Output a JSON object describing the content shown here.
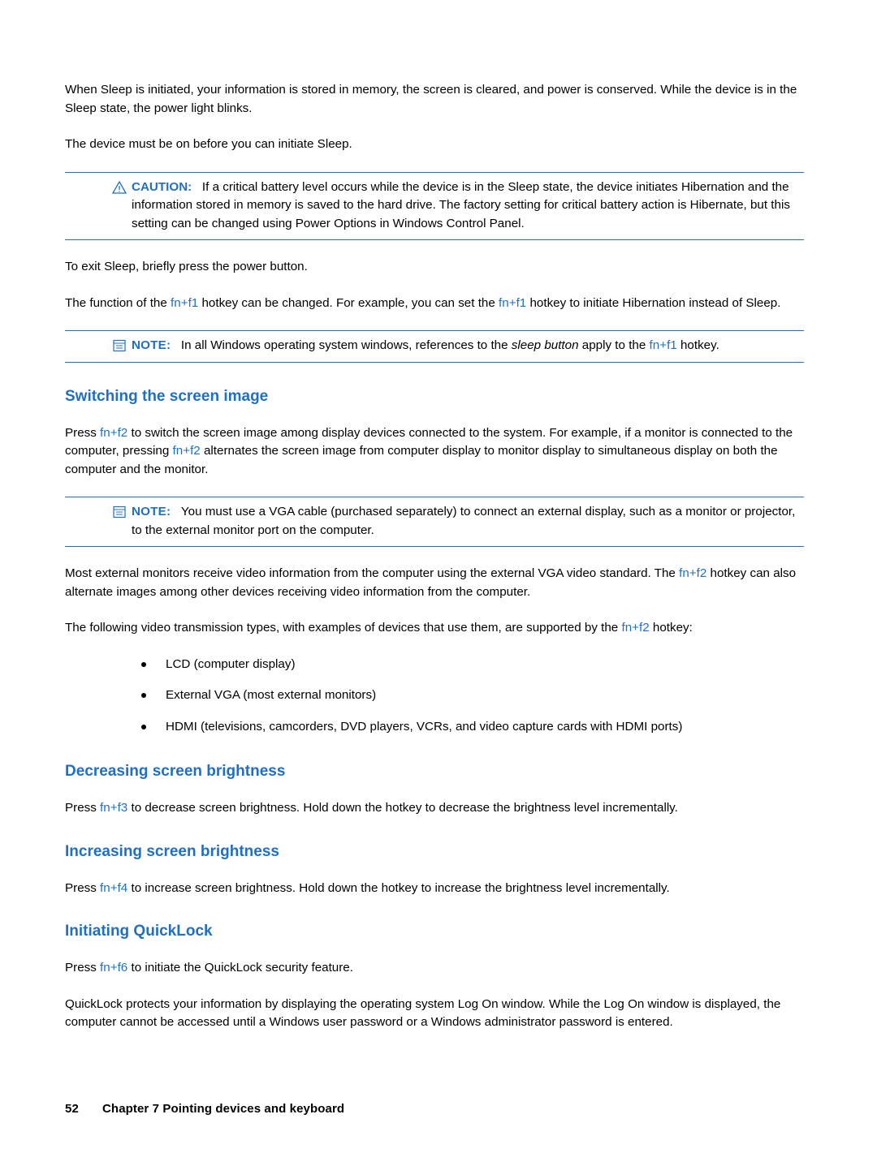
{
  "page": {
    "paragraphs": {
      "p1": "When Sleep is initiated, your information is stored in memory, the screen is cleared, and power is conserved. While the device is in the Sleep state, the power light blinks.",
      "p2": "The device must be on before you can initiate Sleep.",
      "p3": "To exit Sleep, briefly press the power button.",
      "p4a": "The function of the ",
      "p4b": " hotkey can be changed. For example, you can set the ",
      "p4c": " hotkey to initiate Hibernation instead of Sleep.",
      "p5a": "Press ",
      "p5b": " to switch the screen image among display devices connected to the system. For example, if a monitor is connected to the computer, pressing ",
      "p5c": " alternates the screen image from computer display to monitor display to simultaneous display on both the computer and the monitor.",
      "p6a": "Most external monitors receive video information from the computer using the external VGA video standard. The ",
      "p6b": " hotkey can also alternate images among other devices receiving video information from the computer.",
      "p7a": "The following video transmission types, with examples of devices that use them, are supported by the ",
      "p7b": " hotkey:",
      "p8a": "Press ",
      "p8b": " to decrease screen brightness. Hold down the hotkey to decrease the brightness level incrementally.",
      "p9a": "Press ",
      "p9b": " to increase screen brightness. Hold down the hotkey to increase the brightness level incrementally.",
      "p10a": "Press ",
      "p10b": " to initiate the QuickLock security feature.",
      "p11": "QuickLock protects your information by displaying the operating system Log On window. While the Log On window is displayed, the computer cannot be accessed until a Windows user password or a Windows administrator password is entered."
    },
    "callouts": {
      "caution": {
        "label": "CAUTION:",
        "text": "If a critical battery level occurs while the device is in the Sleep state, the device initiates Hibernation and the information stored in memory is saved to the hard drive. The factory setting for critical battery action is Hibernate, but this setting can be changed using Power Options in Windows Control Panel."
      },
      "note1": {
        "label": "NOTE:",
        "text_a": "In all Windows operating system windows, references to the ",
        "text_em": "sleep button",
        "text_b": " apply to the ",
        "text_c": " hotkey."
      },
      "note2": {
        "label": "NOTE:",
        "text": "You must use a VGA cable (purchased separately) to connect an external display, such as a monitor or projector, to the external monitor port on the computer."
      }
    },
    "headings": {
      "h1": "Switching the screen image",
      "h2": "Decreasing screen brightness",
      "h3": "Increasing screen brightness",
      "h4": "Initiating QuickLock"
    },
    "hotkeys": {
      "fn_f1": "fn+f1",
      "fn_f2": "fn+f2",
      "fn_f3": "fn+f3",
      "fn_f4": "fn+f4",
      "fn_f6": "fn+f6"
    },
    "bullets": [
      "LCD (computer display)",
      "External VGA (most external monitors)",
      "HDMI (televisions, camcorders, DVD players, VCRs, and video capture cards with HDMI ports)"
    ],
    "footer": {
      "page_number": "52",
      "chapter": "Chapter 7   Pointing devices and keyboard"
    },
    "colors": {
      "accent": "#1f6fc4",
      "text": "#000000",
      "background": "#ffffff"
    }
  }
}
